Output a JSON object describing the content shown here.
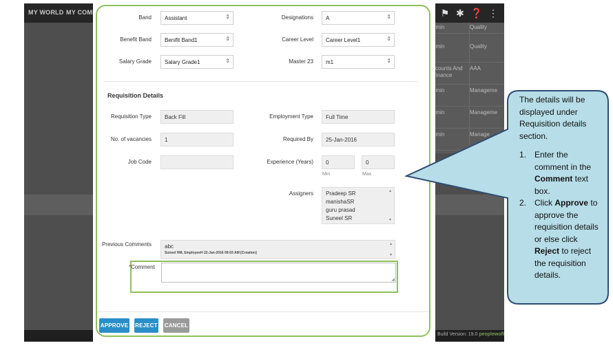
{
  "nav": {
    "my_world": "MY WORLD",
    "my_company": "MY COMPA"
  },
  "bg_table": {
    "rows": [
      {
        "c1": "dmin",
        "c2": "Quality"
      },
      {
        "c1": "dmin",
        "c2": "Quality"
      },
      {
        "c1": "ccounts And Finance",
        "c2": "AAA"
      },
      {
        "c1": "dmin",
        "c2": "Manageme"
      },
      {
        "c1": "dmin",
        "c2": "Manageme"
      },
      {
        "c1": "dmin",
        "c2": "Manage"
      }
    ]
  },
  "footer": {
    "build": "Build Version: 19.0",
    "brand": "peoplewofk"
  },
  "form": {
    "band": {
      "label": "Band",
      "value": "Assistant"
    },
    "designations": {
      "label": "Designations",
      "value": "A"
    },
    "benefit_band": {
      "label": "Benefit Band",
      "value": "Benifit Band1"
    },
    "career_level": {
      "label": "Career Level",
      "value": "Career Level1"
    },
    "salary_grade": {
      "label": "Salary Grade",
      "value": "Salary Grade1"
    },
    "master23": {
      "label": "Master 23",
      "value": "m1"
    }
  },
  "requisition": {
    "title": "Requisition Details",
    "req_type": {
      "label": "Requisition Type",
      "value": "Back Fill"
    },
    "emp_type": {
      "label": "Employment Type",
      "value": "Full Time"
    },
    "vacancies": {
      "label": "No. of vacancies",
      "value": "1"
    },
    "required_by": {
      "label": "Required By",
      "value": "25-Jan-2016"
    },
    "job_code": {
      "label": "Job Code",
      "value": ""
    },
    "experience": {
      "label": "Experience (Years)",
      "min_value": "0",
      "max_value": "0",
      "min_label": "Min",
      "max_label": "Max"
    },
    "assigners": {
      "label": "Assigners",
      "items": [
        "Pradeep SR",
        "manishaSR",
        "guru prasad",
        "Suneel SR"
      ]
    },
    "previous_comments": {
      "label": "Previous Comments",
      "text": "abc",
      "meta": "Suneel HM,  EmployeeH  22-Jan-2016 09:03 AM [Creation]"
    },
    "comment": {
      "label": "Comment",
      "required_mark": "*",
      "value": ""
    }
  },
  "buttons": {
    "approve": "APPROVE",
    "reject": "REJECT",
    "cancel": "CANCEL"
  },
  "callout": {
    "intro": "The details will be displayed under Requisition details section.",
    "step1": {
      "num": "1.",
      "pre": "Enter the comment in the ",
      "bold": "Comment",
      "post": " text box."
    },
    "step2": {
      "num": "2.",
      "pre": "Click ",
      "bold1": "Approve",
      "mid": " to approve the requisition details or else click ",
      "bold2": "Reject",
      "post": " to reject the requisition details."
    }
  },
  "colors": {
    "highlight": "#8fbf5c",
    "callout_fill": "#b6dde8",
    "callout_border": "#2e4d70",
    "primary_button": "#2a8ec8"
  }
}
